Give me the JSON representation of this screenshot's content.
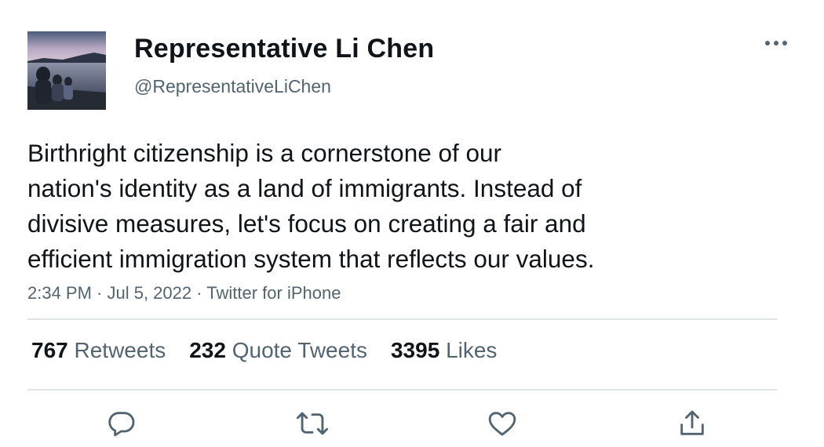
{
  "user": {
    "display_name": "Representative Li Chen",
    "handle": "@RepresentativeLiChen"
  },
  "tweet": {
    "lines": [
      "Birthright citizenship is a cornerstone of our",
      "nation's identity as a land of immigrants. Instead of",
      "divisive measures, let's focus on creating a fair and",
      "efficient immigration system that reflects our values."
    ],
    "meta": "2:34 PM · Jul 5, 2022 · Twitter for iPhone"
  },
  "stats": {
    "retweets": {
      "count": "767",
      "label": "Retweets"
    },
    "quote_tweets": {
      "count": "232",
      "label": "Quote Tweets"
    },
    "likes": {
      "count": "3395",
      "label": "Likes"
    }
  },
  "icons": {
    "more": "more-horizontal-icon",
    "reply": "reply-icon",
    "retweet": "retweet-icon",
    "like": "like-heart-icon",
    "share": "share-icon"
  },
  "colors": {
    "text_primary": "#0f1419",
    "text_secondary": "#536471",
    "divider": "#dfe3e6"
  }
}
